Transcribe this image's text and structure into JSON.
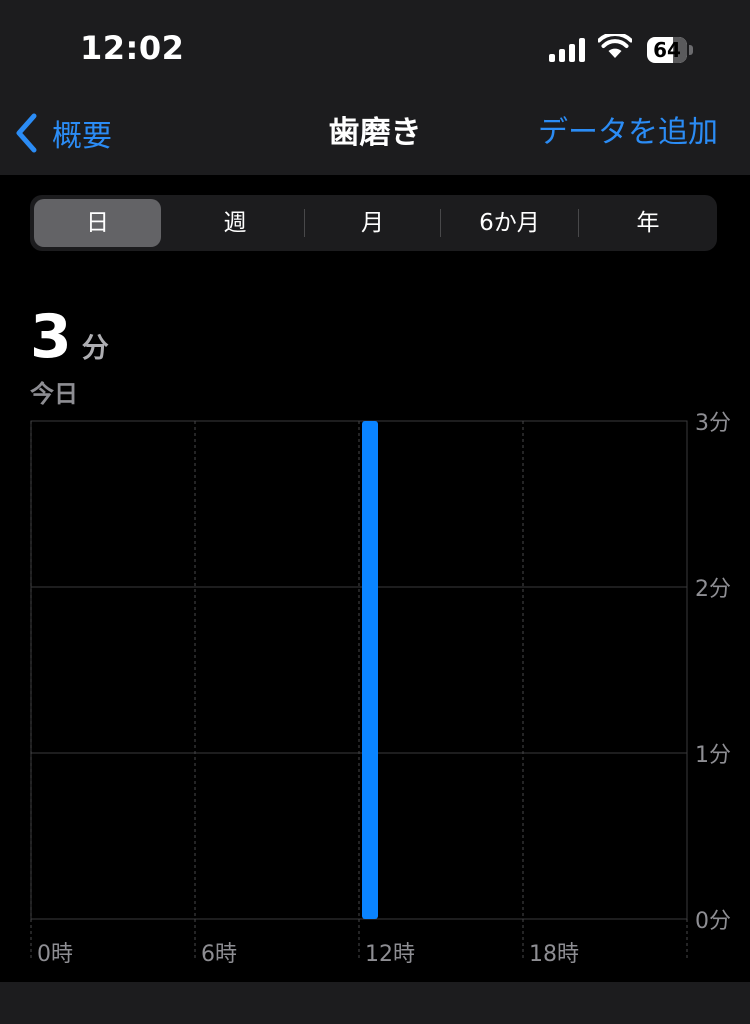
{
  "status_bar": {
    "time": "12:02",
    "battery": "64",
    "battery_level": 0.64
  },
  "nav": {
    "back_label": "概要",
    "title": "歯磨き",
    "add_label": "データを追加"
  },
  "segments": [
    {
      "label": "日",
      "active": true
    },
    {
      "label": "週",
      "active": false
    },
    {
      "label": "月",
      "active": false
    },
    {
      "label": "6か月",
      "active": false
    },
    {
      "label": "年",
      "active": false
    }
  ],
  "summary": {
    "value": "3",
    "unit": "分",
    "period": "今日"
  },
  "colors": {
    "accent": "#2b8cf5",
    "bar": "#0a84ff",
    "background": "#000000",
    "panel": "#1c1c1e"
  },
  "chart_data": {
    "type": "bar",
    "x_ticks": [
      "0時",
      "6時",
      "12時",
      "18時"
    ],
    "y_ticks": [
      "0分",
      "1分",
      "2分",
      "3分"
    ],
    "ylim": [
      0,
      3
    ],
    "x_range_hours": [
      0,
      24
    ],
    "grid": true,
    "series": [
      {
        "points": [
          {
            "hour": 12,
            "minutes": 3
          }
        ]
      }
    ]
  }
}
